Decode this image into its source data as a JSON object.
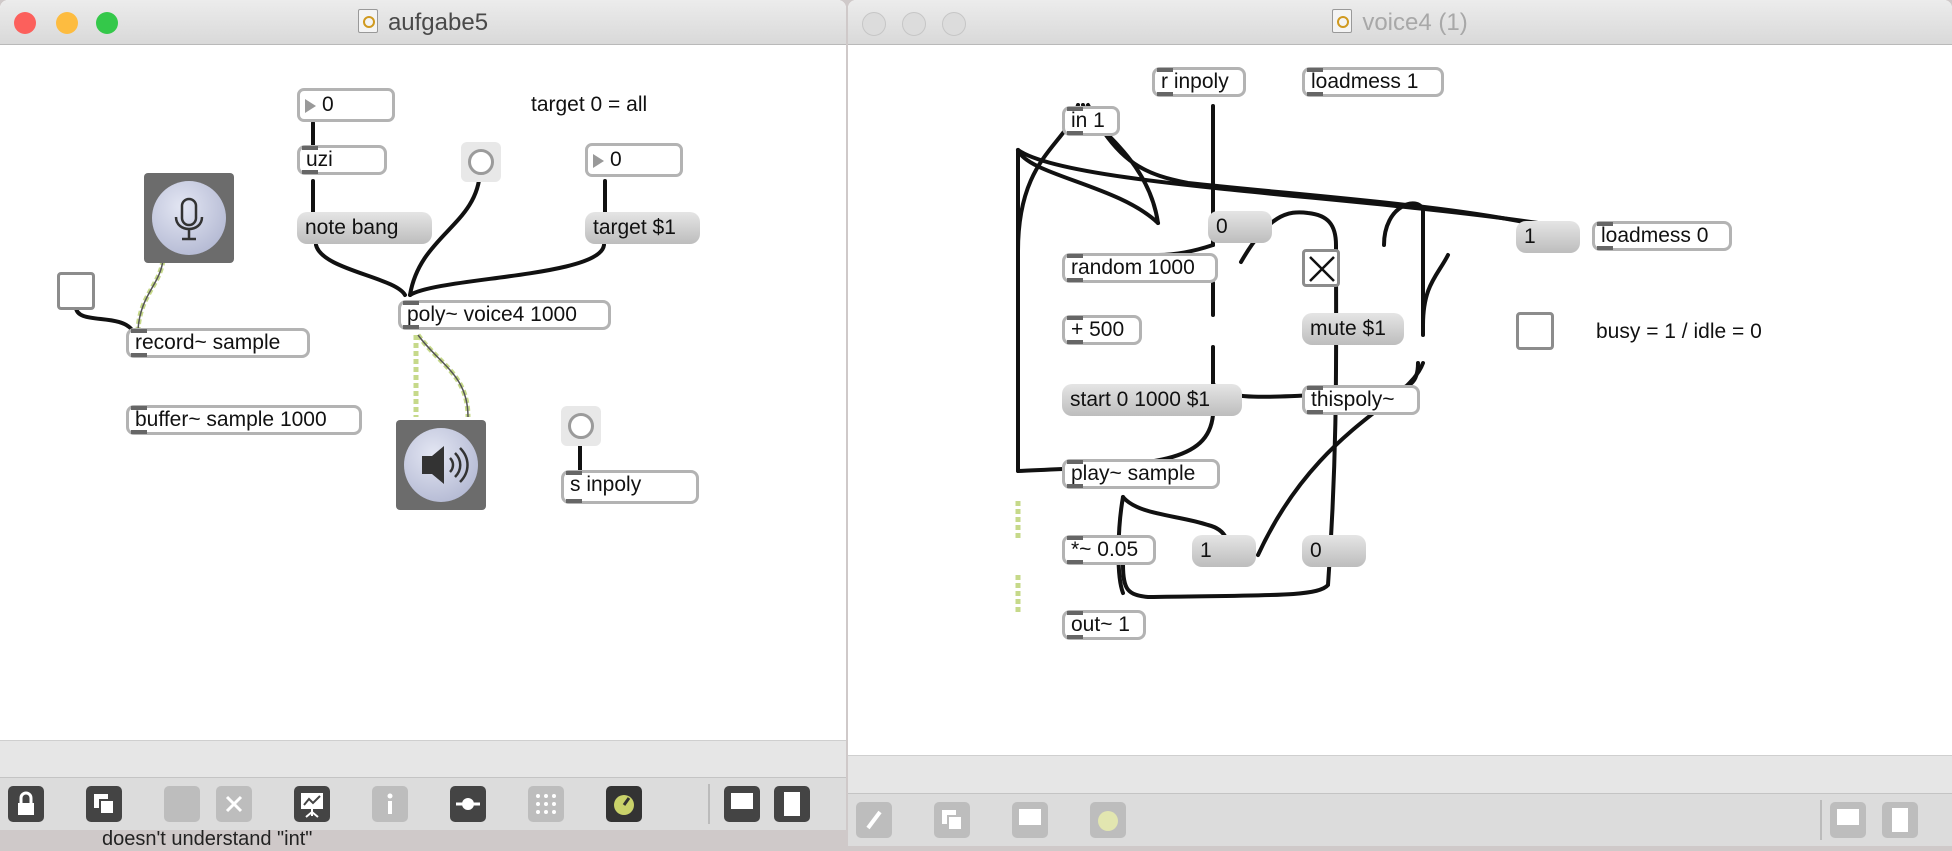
{
  "left_window": {
    "title": "aufgabe5",
    "objects": {
      "num_top": "0",
      "uzi": "uzi",
      "note_bang": "note bang",
      "target_comment": "target 0 = all",
      "num_target": "0",
      "target_msg": "target $1",
      "poly": "poly~ voice4 1000",
      "record": "record~ sample",
      "buffer": "buffer~ sample 1000",
      "s_inpoly": "s inpoly"
    },
    "toolbar_icons": [
      "lock-icon",
      "new-object-icon",
      "binoculars-icon",
      "delete-icon",
      "presentation-icon",
      "inspector-icon",
      "slider-icon",
      "grid-icon",
      "dsp-knob-icon",
      "panel-left-icon",
      "panel-right-icon"
    ]
  },
  "right_window": {
    "title": "voice4 (1)",
    "objects": {
      "r_inpoly": "r inpoly",
      "loadmess1": "loadmess 1",
      "in1": "in 1",
      "msg_zero_top": "0",
      "msg_one_right": "1",
      "loadmess0": "loadmess 0",
      "random": "random 1000",
      "mute": "mute $1",
      "busy_comment": "busy = 1  / idle = 0",
      "plus500": "+ 500",
      "start_msg": "start 0 1000 $1",
      "thispoly": "thispoly~",
      "play": "play~ sample",
      "mult": "*~ 0.05",
      "msg_one_bottom": "1",
      "msg_zero_bottom": "0",
      "out": "out~ 1"
    }
  },
  "background_console_text": "doesn't understand \"int\"",
  "colors": {
    "close": "#fc605c",
    "minimize": "#fdbc40",
    "zoom": "#34c84a",
    "inactive_light": "#dcdcdc",
    "signal_wire": "#c6d98a"
  }
}
